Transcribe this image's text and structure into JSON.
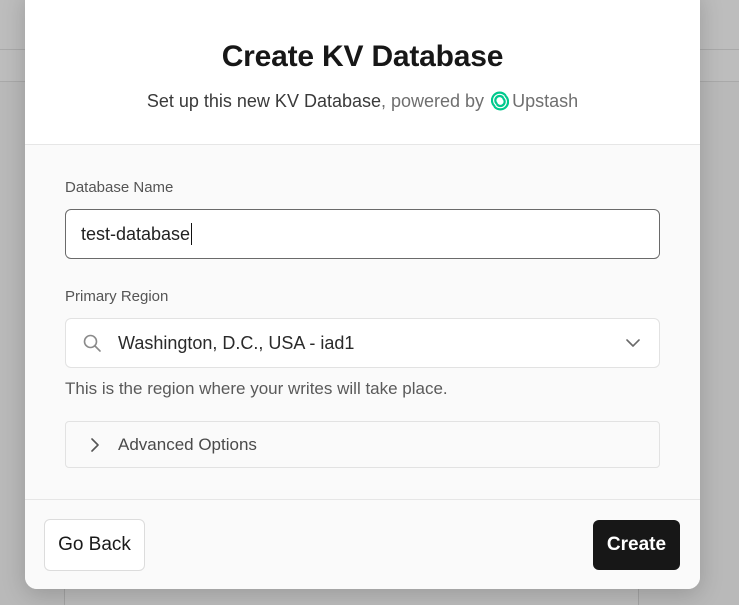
{
  "modal": {
    "title": "Create KV Database",
    "subtitle_main": "Set up this new KV Database",
    "subtitle_powered": ", powered by",
    "provider_name": "Upstash",
    "provider_logo_icon": "upstash-logo-icon",
    "provider_logo_color": "#00c98d"
  },
  "form": {
    "database_name": {
      "label": "Database Name",
      "value": "test-database"
    },
    "primary_region": {
      "label": "Primary Region",
      "value": "Washington, D.C., USA - iad1",
      "help": "This is the region where your writes will take place."
    },
    "advanced_options": {
      "label": "Advanced Options",
      "expanded": false
    }
  },
  "footer": {
    "back_label": "Go Back",
    "create_label": "Create"
  },
  "colors": {
    "primary_button": "#171717",
    "overlay": "#b9b9b9"
  }
}
